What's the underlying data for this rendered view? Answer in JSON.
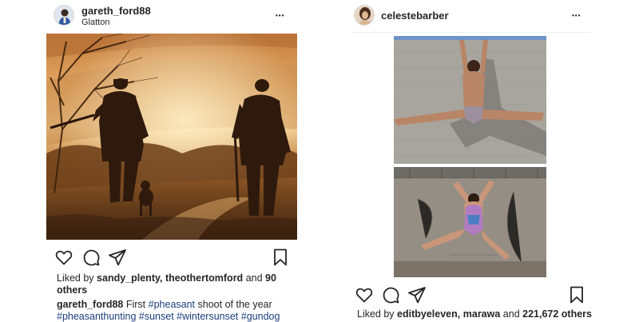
{
  "posts": [
    {
      "username": "gareth_ford88",
      "location": "Glatton",
      "more_icon": "•••",
      "likes": {
        "prefix": "Liked by",
        "user1": "sandy_plenty",
        "sep": ",",
        "user2": "theothertomford",
        "and_text": "and",
        "others_count": "90",
        "others_text": "others"
      },
      "caption": {
        "author": "gareth_ford88",
        "text_before": "First",
        "tag1": "#pheasant",
        "text_after": "shoot of the year",
        "tags_line2": [
          "#pheasanthunting",
          "#sunset",
          "#wintersunset",
          "#gundog"
        ]
      },
      "actions": [
        "heart-icon",
        "comment-icon",
        "share-icon",
        "bookmark-icon"
      ]
    },
    {
      "username": "celestebarber",
      "more_icon": "•••",
      "likes": {
        "prefix": "Liked by",
        "user1": "editbyeleven",
        "sep": ",",
        "user2": "marawa",
        "and_text": "and",
        "others_text": "221,672 others"
      },
      "actions": [
        "heart-icon",
        "comment-icon",
        "share-icon",
        "bookmark-icon"
      ]
    }
  ],
  "colors": {
    "text": "#262626",
    "hashtag": "#1a3d7c",
    "divider": "#efefef",
    "photo_sepia_light": "#e3b27a",
    "photo_sepia_dark": "#4a2c14",
    "wall_grey": "#a9a6a0",
    "sky_blue": "#6f93c9"
  }
}
